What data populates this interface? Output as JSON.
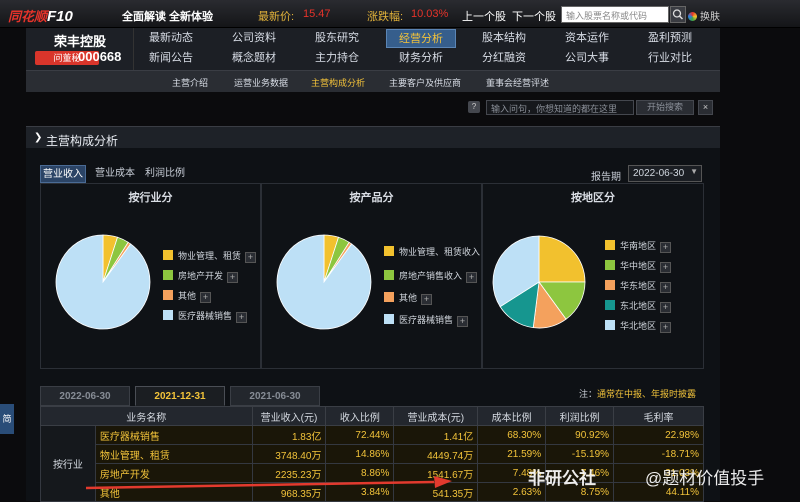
{
  "topbar": {
    "logo_text": "同花顺",
    "logo_suffix": "F10",
    "slogan": "全面解读 全新体验",
    "price_label": "最新价:",
    "price_value": "15.47",
    "change_label": "涨跌幅:",
    "change_value": "10.03%",
    "prev_label": "上一个股",
    "next_label": "下一个股",
    "search_placeholder": "输入股票名称或代码",
    "skin_label": "换肤"
  },
  "stock": {
    "name": "荣丰控股",
    "ask_label": "问董秘",
    "code": "000668"
  },
  "nav": {
    "row1": [
      "最新动态",
      "公司资料",
      "股东研究",
      "经营分析",
      "股本结构",
      "资本运作",
      "盈利预测"
    ],
    "row2": [
      "新闻公告",
      "概念题材",
      "主力持仓",
      "财务分析",
      "分红融资",
      "公司大事",
      "行业对比"
    ],
    "active": "经营分析"
  },
  "subnav": {
    "items": [
      "主营介绍",
      "运营业务数据",
      "主营构成分析",
      "主要客户及供应商",
      "董事会经营评述"
    ],
    "active": "主营构成分析"
  },
  "askbar": {
    "placeholder": "输入问句，你想知道的都在这里",
    "button": "开始搜索",
    "close": "×"
  },
  "section": {
    "title": "主营构成分析"
  },
  "tabs": [
    "营业收入",
    "营业成本",
    "利润比例"
  ],
  "period": {
    "label": "报告期",
    "value": "2022-06-30"
  },
  "charts": [
    {
      "title": "按行业分",
      "legend": [
        "物业管理、租赁",
        "房地产开发",
        "其他",
        "医疗器械销售"
      ]
    },
    {
      "title": "按产品分",
      "legend": [
        "物业管理、租赁收入",
        "房地产销售收入",
        "其他",
        "医疗器械销售"
      ]
    },
    {
      "title": "按地区分",
      "legend": [
        "华南地区",
        "华中地区",
        "华东地区",
        "东北地区",
        "华北地区"
      ]
    }
  ],
  "chart_data": [
    {
      "type": "pie",
      "title": "按行业分",
      "labels": [
        "物业管理、租赁",
        "房地产开发",
        "其他",
        "医疗器械销售"
      ],
      "values": [
        5.0,
        4.0,
        1.0,
        90.0
      ],
      "colors": [
        "#f2c12e",
        "#8dc63f",
        "#f4a15d",
        "#bde0f6"
      ]
    },
    {
      "type": "pie",
      "title": "按产品分",
      "labels": [
        "物业管理、租赁收入",
        "房地产销售收入",
        "其他",
        "医疗器械销售"
      ],
      "values": [
        5.0,
        4.0,
        1.0,
        90.0
      ],
      "colors": [
        "#f2c12e",
        "#8dc63f",
        "#f4a15d",
        "#bde0f6"
      ]
    },
    {
      "type": "pie",
      "title": "按地区分",
      "labels": [
        "华南地区",
        "华中地区",
        "华东地区",
        "东北地区",
        "华北地区"
      ],
      "values": [
        25.0,
        15.0,
        12.0,
        14.0,
        34.0
      ],
      "colors": [
        "#f2c12e",
        "#8dc63f",
        "#f4a15d",
        "#16968f",
        "#bde0f6"
      ]
    }
  ],
  "date_tabs": [
    "2022-06-30",
    "2021-12-31",
    "2021-06-30"
  ],
  "active_date_tab": "2021-12-31",
  "note": {
    "prefix": "注：",
    "text": "通常在中报、年报时披露"
  },
  "table": {
    "headers": [
      "业务名称",
      "营业收入(元)",
      "收入比例",
      "营业成本(元)",
      "成本比例",
      "利润比例",
      "毛利率"
    ],
    "group": "按行业",
    "rows": [
      [
        "医疗器械销售",
        "1.83亿",
        "72.44%",
        "1.41亿",
        "68.30%",
        "90.92%",
        "22.98%"
      ],
      [
        "物业管理、租赁",
        "3748.40万",
        "14.86%",
        "4449.74万",
        "21.59%",
        "-15.19%",
        "-18.71%"
      ],
      [
        "房地产开发",
        "2235.23万",
        "8.86%",
        "1541.67万",
        "7.48%",
        "7.46%",
        "31.03%"
      ],
      [
        "其他",
        "968.35万",
        "3.84%",
        "541.35万",
        "2.63%",
        "8.75%",
        "44.11%"
      ]
    ]
  },
  "side_tab": "简",
  "watermark": {
    "left": "非研公社",
    "right": "@题材价值投手"
  }
}
